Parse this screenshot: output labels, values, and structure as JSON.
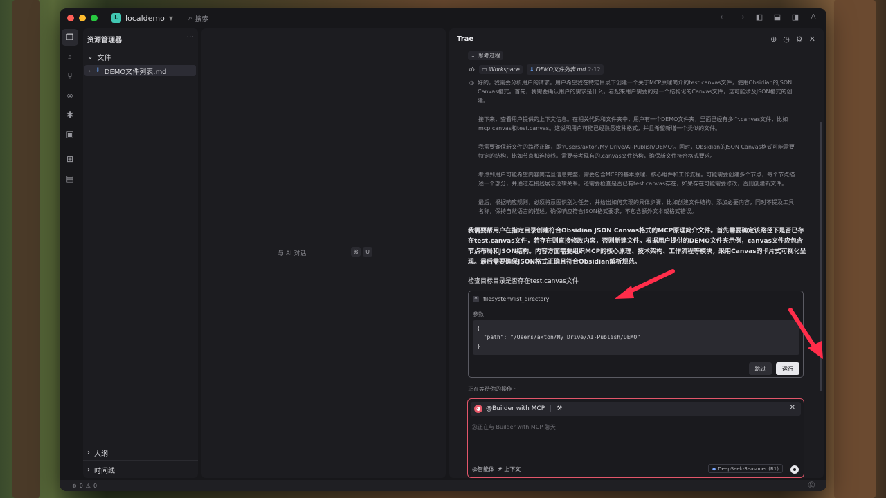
{
  "window": {
    "project_name": "localdemo",
    "search_label": "搜索",
    "project_badge": "L"
  },
  "explorer": {
    "title": "资源管理器",
    "more": "···",
    "section_files": "文件",
    "file_name": "DEMO文件列表.md",
    "section_outline": "大纲",
    "section_timeline": "时间线"
  },
  "editor": {
    "hint": "与 AI 对话",
    "shortcut_cmd": "⌘",
    "shortcut_key": "U"
  },
  "chat": {
    "title": "Trae",
    "think_label": "思考过程",
    "workspace_label": "Workspace",
    "context_file": "DEMO文件列表.md",
    "context_range": "2-12",
    "think_first": "好的，我需要分析用户的请求。用户希望我在特定目录下创建一个关于MCP原理简介的test.canvas文件，使用Obsidian的JSON Canvas格式。首先，我需要确认用户的需求是什么。看起来用户需要的是一个结构化的Canvas文件，这可能涉及JSON格式的创建。",
    "think_paragraphs": [
      "接下来，查看用户提供的上下文信息。在相关代码和文件夹中，用户有一个DEMO文件夹，里面已经有多个.canvas文件，比如mcp.canvas和test.canvas。这说明用户可能已经熟悉这种格式，并且希望新增一个类似的文件。",
      "我需要确保新文件的路径正确，即'/Users/axton/My Drive/AI-Publish/DEMO'。同时，Obsidian的JSON Canvas格式可能需要特定的结构，比如节点和连接线。需要参考现有的.canvas文件结构，确保新文件符合格式要求。",
      "考虑到用户可能希望内容简洁且信息完整，需要包含MCP的基本原理、核心组件和工作流程。可能需要创建多个节点，每个节点描述一个部分，并通过连接线展示逻辑关系。还需要检查是否已有test.canvas存在，如果存在可能需要修改，否则创建新文件。",
      "最后，根据响应规则，必须将意图识别为任务，并给出如何实现的具体步骤，比如创建文件结构、添加必要内容，同时不提及工具名称，保持自然语言的描述。确保响应符合JSON格式要求，不包含额外文本或格式错误。"
    ],
    "answer": "我需要帮用户在指定目录创建符合Obsidian JSON Canvas格式的MCP原理简介文件。首先需要确定该路径下是否已存在test.canvas文件，若存在则直接修改内容，否则新建文件。根据用户提供的DEMO文件夹示例，canvas文件应包含节点布局和JSON结构。内容方面需要组织MCP的核心原理、技术架构、工作流程等模块，采用Canvas的卡片式可视化呈现。最后需要确保JSON格式正确且符合Obsidian解析规范。",
    "check_line": "检查目标目录是否存在test.canvas文件",
    "tool_name": "filesystem/list_directory",
    "params_label": "参数",
    "params_code": "{\n  \"path\": \"/Users/axton/My Drive/AI-Publish/DEMO\"\n}",
    "skip_label": "跳过",
    "run_label": "运行",
    "waiting": "正在等待你的操作 ·",
    "agent_name": "@Builder with MCP",
    "input_placeholder": "您正在与 Builder with MCP 聊天",
    "footer_agent": "@智能体",
    "footer_context": "# 上下文",
    "model": "DeepSeek-Reasoner (R1)"
  },
  "status": {
    "errors": "0",
    "warnings": "0"
  }
}
